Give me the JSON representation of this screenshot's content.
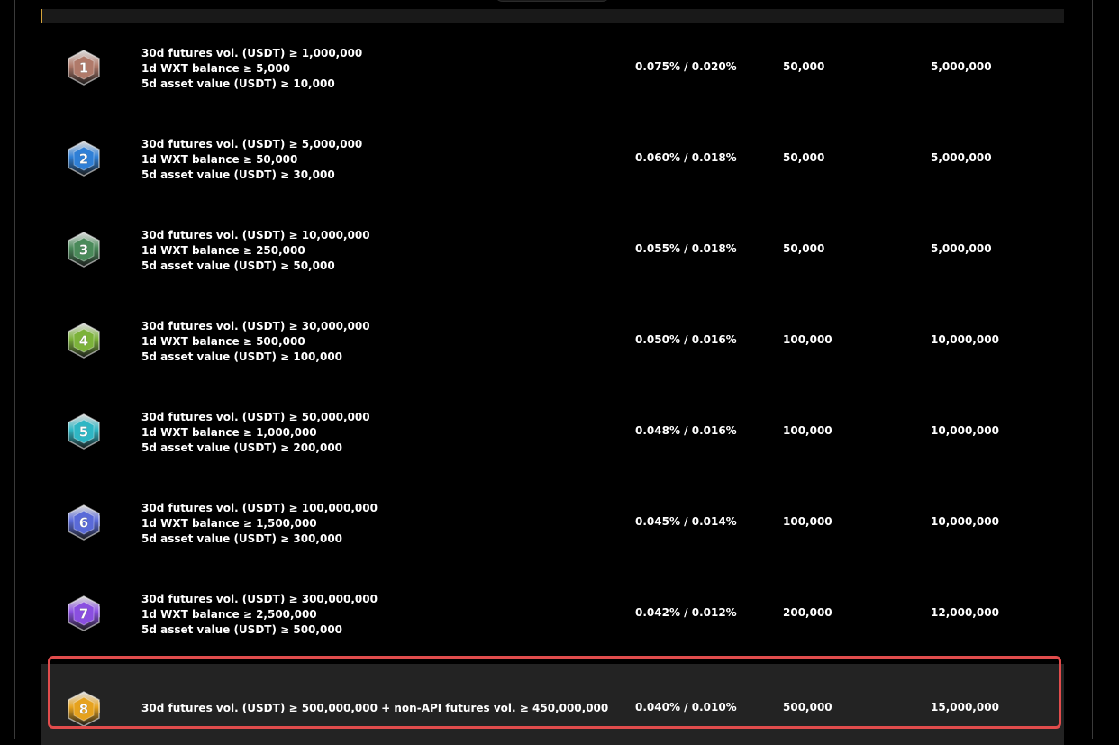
{
  "tiers": [
    {
      "level": "1",
      "badge_color": "#b07a6a",
      "requirements": [
        "30d futures vol. (USDT) ≥ 1,000,000",
        "1d WXT balance ≥ 5,000",
        "5d asset value (USDT) ≥ 10,000"
      ],
      "fee": "0.075% / 0.020%",
      "limit": "50,000",
      "withdraw": "5,000,000"
    },
    {
      "level": "2",
      "badge_color": "#2f7fd6",
      "requirements": [
        "30d futures vol. (USDT) ≥ 5,000,000",
        "1d WXT balance ≥ 50,000",
        "5d asset value (USDT) ≥ 30,000"
      ],
      "fee": "0.060% / 0.018%",
      "limit": "50,000",
      "withdraw": "5,000,000"
    },
    {
      "level": "3",
      "badge_color": "#4a8a5a",
      "requirements": [
        "30d futures vol. (USDT) ≥ 10,000,000",
        "1d WXT balance ≥ 250,000",
        "5d asset value (USDT) ≥ 50,000"
      ],
      "fee": "0.055% / 0.018%",
      "limit": "50,000",
      "withdraw": "5,000,000"
    },
    {
      "level": "4",
      "badge_color": "#7cb23a",
      "requirements": [
        "30d futures vol. (USDT) ≥ 30,000,000",
        "1d WXT balance ≥ 500,000",
        "5d asset value (USDT) ≥ 100,000"
      ],
      "fee": "0.050% / 0.016%",
      "limit": "100,000",
      "withdraw": "10,000,000"
    },
    {
      "level": "5",
      "badge_color": "#2fb6c4",
      "requirements": [
        "30d futures vol. (USDT) ≥ 50,000,000",
        "1d WXT balance ≥ 1,000,000",
        "5d asset value (USDT) ≥ 200,000"
      ],
      "fee": "0.048% / 0.016%",
      "limit": "100,000",
      "withdraw": "10,000,000"
    },
    {
      "level": "6",
      "badge_color": "#5a6ad8",
      "requirements": [
        "30d futures vol. (USDT) ≥ 100,000,000",
        "1d WXT balance ≥ 1,500,000",
        "5d asset value (USDT) ≥ 300,000"
      ],
      "fee": "0.045% / 0.014%",
      "limit": "100,000",
      "withdraw": "10,000,000"
    },
    {
      "level": "7",
      "badge_color": "#8a4fe0",
      "requirements": [
        "30d futures vol. (USDT) ≥ 300,000,000",
        "1d WXT balance ≥ 2,500,000",
        "5d asset value (USDT) ≥ 500,000"
      ],
      "fee": "0.042% / 0.012%",
      "limit": "200,000",
      "withdraw": "12,000,000"
    },
    {
      "level": "8",
      "badge_color": "#e6a21e",
      "requirements": [
        "30d futures vol. (USDT) ≥ 500,000,000 + non-API futures vol. ≥ 450,000,000"
      ],
      "fee": "0.040% / 0.010%",
      "limit": "500,000",
      "withdraw": "15,000,000"
    }
  ],
  "colors": {
    "background": "#000000",
    "highlight_row": "#232323",
    "highlight_border": "#e14c4c",
    "accent": "#d6a43a"
  }
}
